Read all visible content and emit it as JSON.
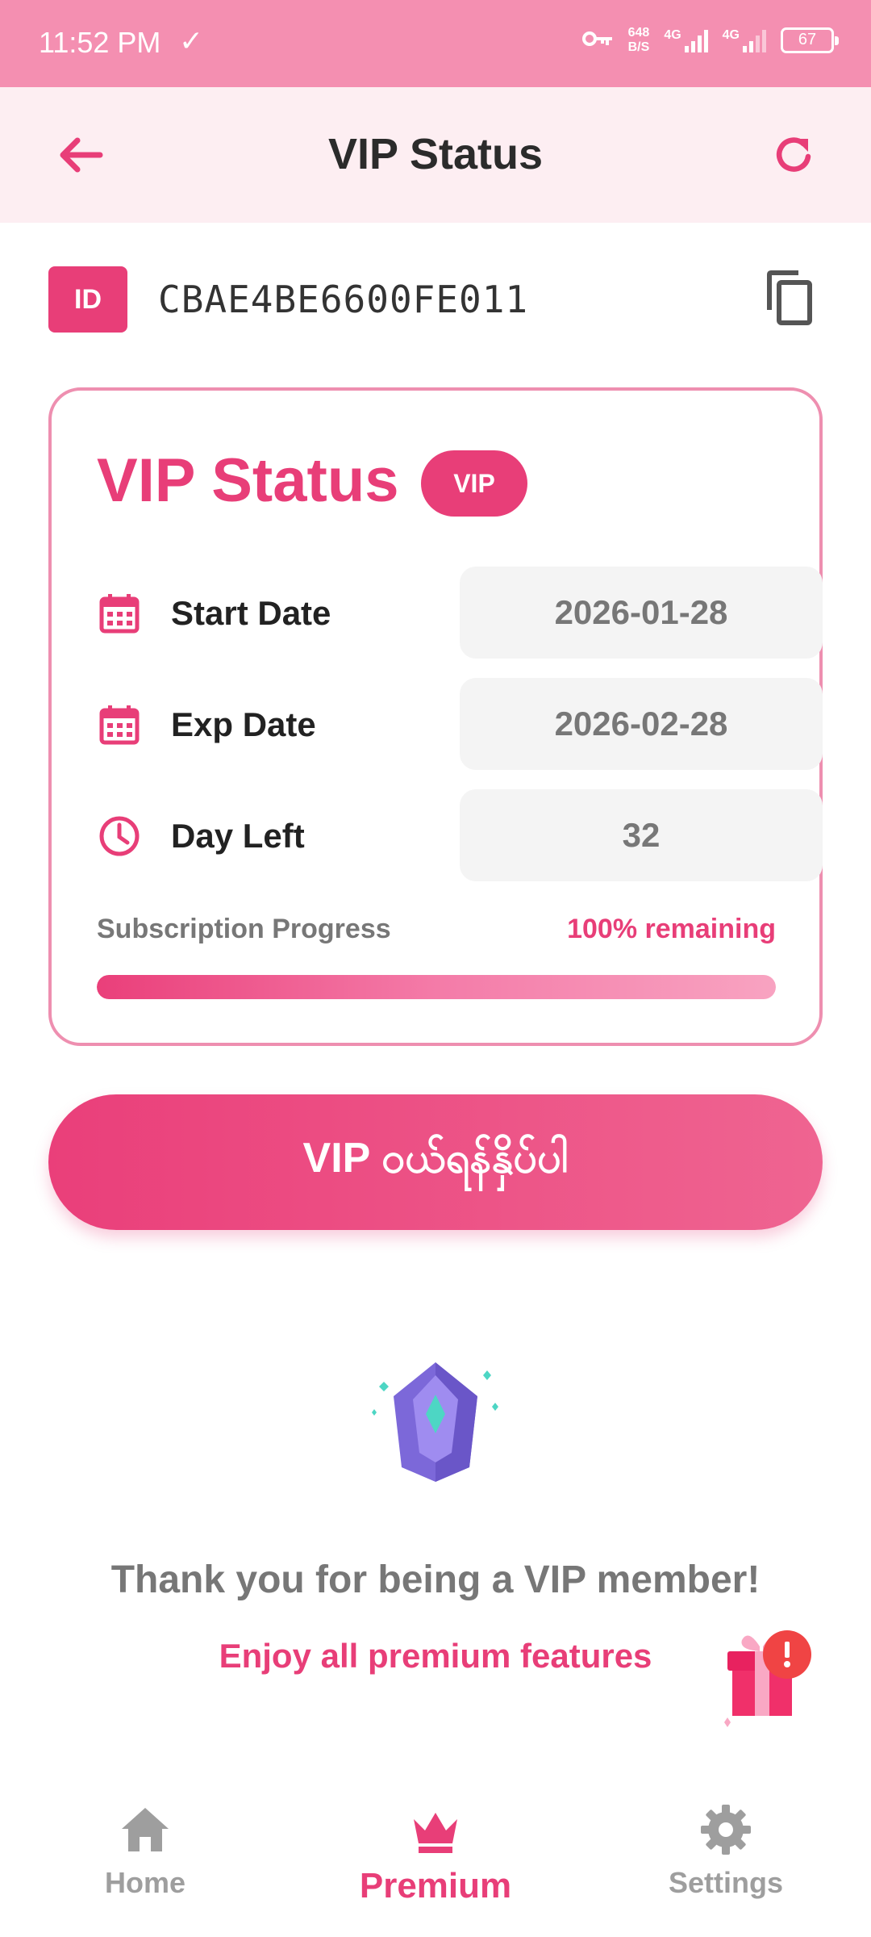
{
  "status_bar": {
    "time": "11:52 PM",
    "net_speed_value": "648",
    "net_speed_unit": "B/S",
    "network_1": "4G",
    "network_2": "4G",
    "battery": "67"
  },
  "app_bar": {
    "title": "VIP Status",
    "back_icon": "arrow-left-icon",
    "refresh_icon": "refresh-icon"
  },
  "id_row": {
    "badge": "ID",
    "value": "CBAE4BE6600FE011",
    "copy_icon": "copy-icon"
  },
  "vip_card": {
    "title": "VIP Status",
    "badge": "VIP",
    "rows": [
      {
        "label": "Start Date",
        "value": "2026-01-28",
        "icon": "calendar-icon"
      },
      {
        "label": "Exp Date",
        "value": "2026-02-28",
        "icon": "calendar-icon"
      },
      {
        "label": "Day Left",
        "value": "32",
        "icon": "clock-icon"
      }
    ],
    "progress_label": "Subscription Progress",
    "progress_remaining": "100% remaining",
    "progress_fraction": 1.0
  },
  "buy_button": {
    "label": "VIP ဝယ်ရန်နှိပ်ပါ"
  },
  "thanks": {
    "line1": "Thank you for being a VIP member!",
    "line2": "Enjoy all premium features"
  },
  "bottom_nav": {
    "items": [
      {
        "label": "Home",
        "icon": "home-icon",
        "active": false
      },
      {
        "label": "Premium",
        "icon": "crown-icon",
        "active": true
      },
      {
        "label": "Settings",
        "icon": "gear-icon",
        "active": false
      }
    ]
  },
  "colors": {
    "accent": "#e83e78",
    "status_bar": "#f48fb1",
    "app_bar": "#fdeef2",
    "inactive": "#9e9e9e"
  }
}
